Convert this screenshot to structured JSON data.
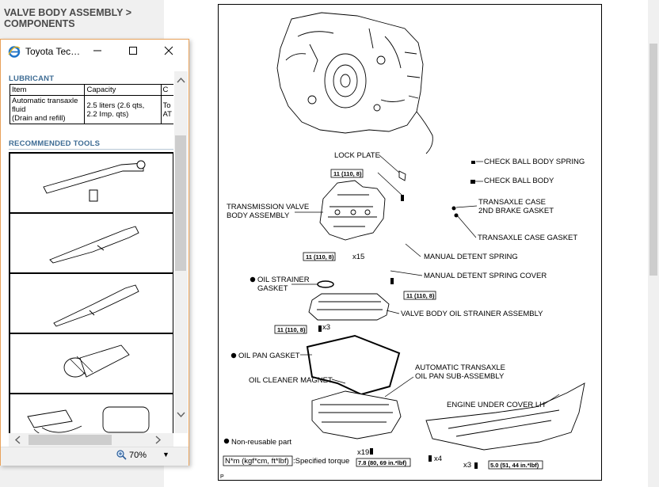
{
  "breadcrumb": "VALVE BODY ASSEMBLY > COMPONENTS",
  "popup": {
    "title": "Toyota Tec…",
    "lubricant_header": "LUBRICANT",
    "table": {
      "headers": [
        "Item",
        "Capacity",
        "C"
      ],
      "row": [
        "Automatic transaxle fluid",
        "(Drain and refill)",
        "2.5 liters (2.6 qts,",
        "2.2 Imp. qts)",
        "To",
        "AT"
      ]
    },
    "tools_header": "RECOMMENDED TOOLS",
    "zoom": "70%"
  },
  "diagram": {
    "labels": {
      "lock_plate": "LOCK PLATE",
      "check_ball_spring": "CHECK BALL BODY SPRING",
      "check_ball_body": "CHECK BALL BODY",
      "brake_gasket_1": "TRANSAXLE CASE",
      "brake_gasket_2": "2ND BRAKE GASKET",
      "valve_body_1": "TRANSMISSION VALVE",
      "valve_body_2": "BODY ASSEMBLY",
      "case_gasket": "TRANSAXLE CASE GASKET",
      "detent_spring": "MANUAL DETENT SPRING",
      "detent_cover": "MANUAL DETENT SPRING COVER",
      "strainer_gasket_1": "OIL STRAINER",
      "strainer_gasket_2": "GASKET",
      "strainer_assy": "VALVE BODY OIL STRAINER ASSEMBLY",
      "pan_gasket": "OIL PAN GASKET",
      "pan_1": "AUTOMATIC TRANSAXLE",
      "pan_2": "OIL PAN SUB-ASSEMBLY",
      "cleaner_magnet": "OIL CLEANER MAGNET",
      "under_cover": "ENGINE UNDER COVER LH",
      "non_reusable": "Non-reusable part",
      "torque_legend": "N*m (kgf*cm, ft*lbf)",
      "specified_torque": ":Specified torque",
      "page_marker": "P"
    },
    "torques": {
      "t1": "11 (110, 8)",
      "t2": "11 (110, 8)",
      "t3": "11 (110, 8)",
      "t4": "11 (110, 8)",
      "t5": "7.8 (80, 69 in.*lbf)",
      "t6": "5.0 (51, 44 in.*lbf)"
    },
    "counts": {
      "x15": "x15",
      "x3a": "x3",
      "x19": "x19",
      "x4": "x4",
      "x3b": "x3"
    }
  }
}
